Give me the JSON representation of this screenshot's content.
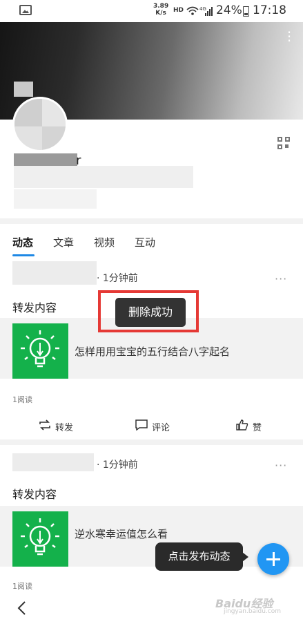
{
  "status_bar": {
    "speed": "3.89",
    "speed_unit": "K/s",
    "hd": "HD",
    "network": "4G",
    "battery": "24%",
    "time": "17:18"
  },
  "tabs": [
    {
      "label": "动态"
    },
    {
      "label": "文章"
    },
    {
      "label": "视频"
    },
    {
      "label": "互动"
    }
  ],
  "posts": [
    {
      "time": "· 1分钟前",
      "more": "···",
      "repost": "转发内容",
      "link_title": "怎样用用宝宝的五行结合八字起名",
      "reads": "1阅读",
      "actions": {
        "share": "转发",
        "comment": "评论",
        "like": "赞"
      }
    },
    {
      "time": "· 1分钟前",
      "more": "···",
      "repost": "转发内容",
      "link_title": "逆水寒幸运值怎么看",
      "reads": "1阅读"
    }
  ],
  "toast": "删除成功",
  "tip": "点击发布动态",
  "watermark": {
    "main": "Baidu经验",
    "sub": "jingyan.baidu.com"
  },
  "profile": {
    "name_fragment": "r"
  },
  "colors": {
    "accent": "#1e88e5",
    "highlight": "#e53935",
    "fab": "#2196f3",
    "thumb": "#14b14b"
  }
}
